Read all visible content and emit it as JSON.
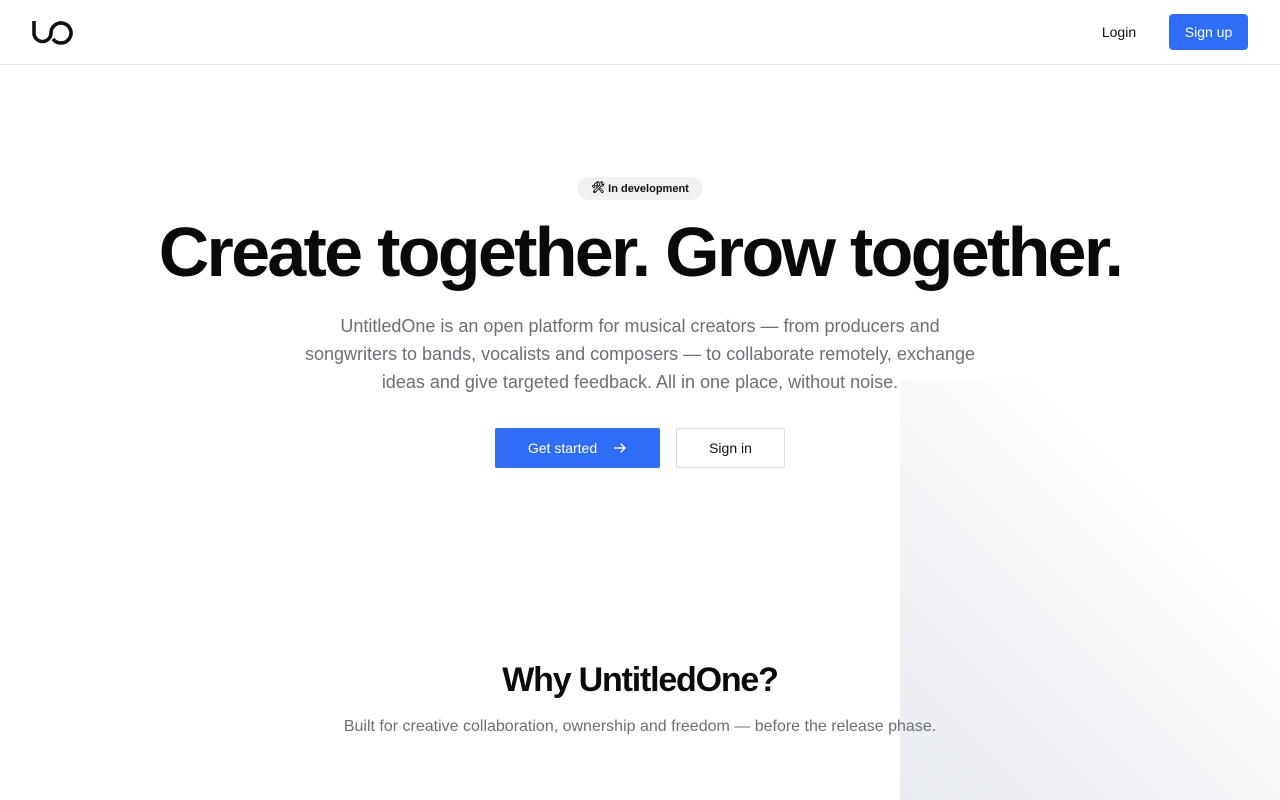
{
  "header": {
    "logo_icon": "untitledone-logo-icon",
    "login_label": "Login",
    "signup_label": "Sign up"
  },
  "hero": {
    "badge_icon": "hammer-wrench-icon",
    "badge_label": "In development",
    "title": "Create together. Grow together.",
    "description": "UntitledOne is an open platform for musical creators — from producers and songwriters to bands, vocalists and composers — to collaborate remotely, exchange ideas and give targeted feedback. All in one place, without noise.",
    "primary_cta_label": "Get started",
    "primary_cta_icon": "arrow-right-icon",
    "secondary_cta_label": "Sign in"
  },
  "why": {
    "title": "Why UntitledOne?",
    "subtitle": "Built for creative collaboration, ownership and freedom — before the release phase."
  },
  "colors": {
    "accent": "#2f6df6",
    "text_primary": "#0a0a0a",
    "text_muted": "#6b6f76",
    "border": "#e5e7eb",
    "badge_bg": "#f1f1f3"
  }
}
